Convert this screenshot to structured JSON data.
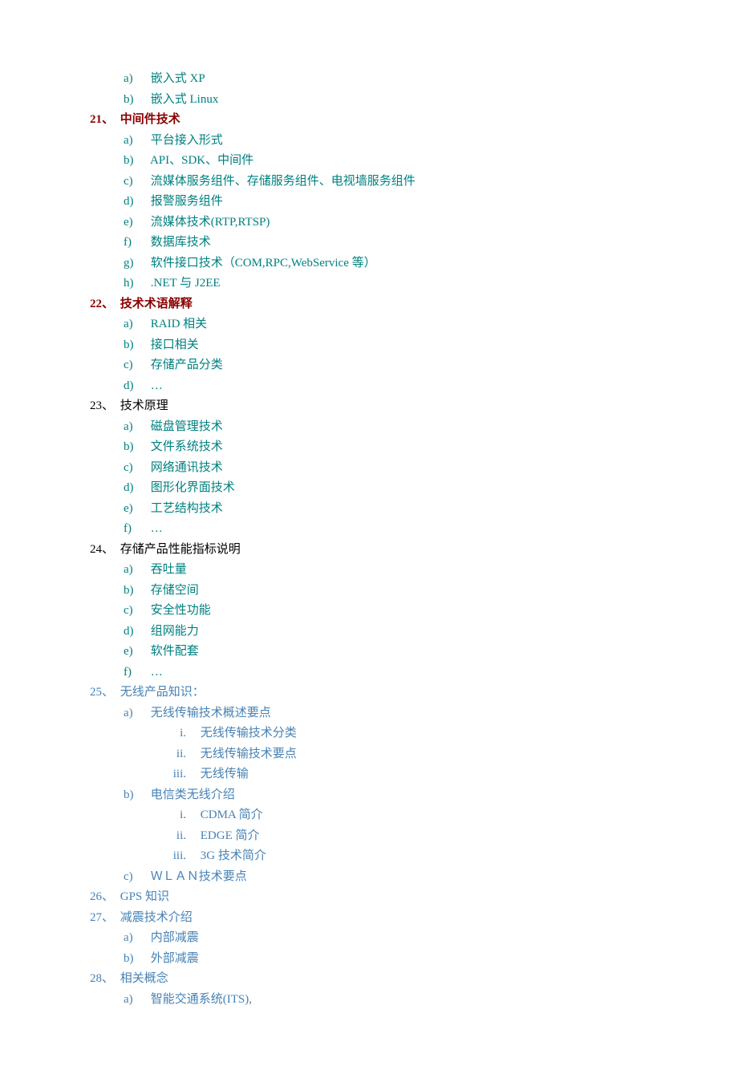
{
  "items": [
    {
      "lvl": 2,
      "cls": "teal",
      "num": "a)",
      "text": "嵌入式 XP"
    },
    {
      "lvl": 2,
      "cls": "teal",
      "num": "b)",
      "text": "嵌入式 Linux"
    },
    {
      "lvl": 1,
      "cls": "dark-red bold",
      "num": "21、",
      "text": "中间件技术"
    },
    {
      "lvl": 2,
      "cls": "teal",
      "num": "a)",
      "text": "平台接入形式"
    },
    {
      "lvl": 2,
      "cls": "teal",
      "num": "b)",
      "text": "API、SDK、中间件"
    },
    {
      "lvl": 2,
      "cls": "teal",
      "num": "c)",
      "text": "流媒体服务组件、存储服务组件、电视墙服务组件"
    },
    {
      "lvl": 2,
      "cls": "teal",
      "num": "d)",
      "text": "报警服务组件"
    },
    {
      "lvl": 2,
      "cls": "teal",
      "num": "e)",
      "text": "流媒体技术(RTP,RTSP)"
    },
    {
      "lvl": 2,
      "cls": "teal",
      "num": "f)",
      "text": "数据库技术"
    },
    {
      "lvl": 2,
      "cls": "teal",
      "num": "g)",
      "text": "软件接口技术（COM,RPC,WebService 等）"
    },
    {
      "lvl": 2,
      "cls": "teal",
      "num": "h)",
      "text": ".NET  与 J2EE"
    },
    {
      "lvl": 1,
      "cls": "dark-red bold",
      "num": "22、",
      "text": "技术术语解释"
    },
    {
      "lvl": 2,
      "cls": "teal",
      "num": "a)",
      "text": "RAID 相关"
    },
    {
      "lvl": 2,
      "cls": "teal",
      "num": "b)",
      "text": "接口相关"
    },
    {
      "lvl": 2,
      "cls": "teal",
      "num": "c)",
      "text": "存储产品分类"
    },
    {
      "lvl": 2,
      "cls": "teal",
      "num": "d)",
      "text": "…"
    },
    {
      "lvl": 1,
      "cls": "black",
      "num": "23、",
      "text": "技术原理"
    },
    {
      "lvl": 2,
      "cls": "teal",
      "num": "a)",
      "text": "磁盘管理技术"
    },
    {
      "lvl": 2,
      "cls": "teal",
      "num": "b)",
      "text": "文件系统技术"
    },
    {
      "lvl": 2,
      "cls": "teal",
      "num": "c)",
      "text": "网络通讯技术"
    },
    {
      "lvl": 2,
      "cls": "teal",
      "num": "d)",
      "text": "图形化界面技术"
    },
    {
      "lvl": 2,
      "cls": "teal",
      "num": "e)",
      "text": "工艺结构技术"
    },
    {
      "lvl": 2,
      "cls": "teal",
      "num": "f)",
      "text": "…"
    },
    {
      "lvl": 1,
      "cls": "black",
      "num": "24、",
      "text": "存储产品性能指标说明"
    },
    {
      "lvl": 2,
      "cls": "teal",
      "num": "a)",
      "text": "吞吐量"
    },
    {
      "lvl": 2,
      "cls": "teal",
      "num": "b)",
      "text": "存储空间"
    },
    {
      "lvl": 2,
      "cls": "teal",
      "num": "c)",
      "text": "安全性功能"
    },
    {
      "lvl": 2,
      "cls": "teal",
      "num": "d)",
      "text": "组网能力"
    },
    {
      "lvl": 2,
      "cls": "teal",
      "num": "e)",
      "text": "软件配套"
    },
    {
      "lvl": 2,
      "cls": "teal",
      "num": "f)",
      "text": "…"
    },
    {
      "lvl": 1,
      "cls": "steel",
      "num": "25、",
      "text": "无线产品知识："
    },
    {
      "lvl": 2,
      "cls": "steel",
      "num": "a)",
      "text": "无线传输技术概述要点"
    },
    {
      "lvl": 3,
      "cls": "steel",
      "num": "i.",
      "text": "无线传输技术分类"
    },
    {
      "lvl": 3,
      "cls": "steel",
      "num": "ii.",
      "text": "无线传输技术要点"
    },
    {
      "lvl": 3,
      "cls": "steel",
      "num": "iii.",
      "text": "无线传输"
    },
    {
      "lvl": 2,
      "cls": "steel",
      "num": "b)",
      "text": "电信类无线介绍"
    },
    {
      "lvl": 3,
      "cls": "steel",
      "num": "i.",
      "text": "CDMA 简介"
    },
    {
      "lvl": 3,
      "cls": "steel",
      "num": "ii.",
      "text": "EDGE 简介"
    },
    {
      "lvl": 3,
      "cls": "steel",
      "num": "iii.",
      "text": "3G 技术简介"
    },
    {
      "lvl": 2,
      "cls": "steel",
      "num": "c)",
      "text": "ＷＬＡＮ技术要点"
    },
    {
      "lvl": 1,
      "cls": "steel",
      "num": "26、",
      "text": "GPS 知识"
    },
    {
      "lvl": 1,
      "cls": "steel",
      "num": "27、",
      "text": "减震技术介绍"
    },
    {
      "lvl": 2,
      "cls": "steel",
      "num": "a)",
      "text": "内部减震"
    },
    {
      "lvl": 2,
      "cls": "steel",
      "num": "b)",
      "text": "外部减震"
    },
    {
      "lvl": 1,
      "cls": "steel",
      "num": "28、",
      "text": "相关概念"
    },
    {
      "lvl": 2,
      "cls": "steel",
      "num": "a)",
      "text": "智能交通系统(ITS),"
    }
  ]
}
